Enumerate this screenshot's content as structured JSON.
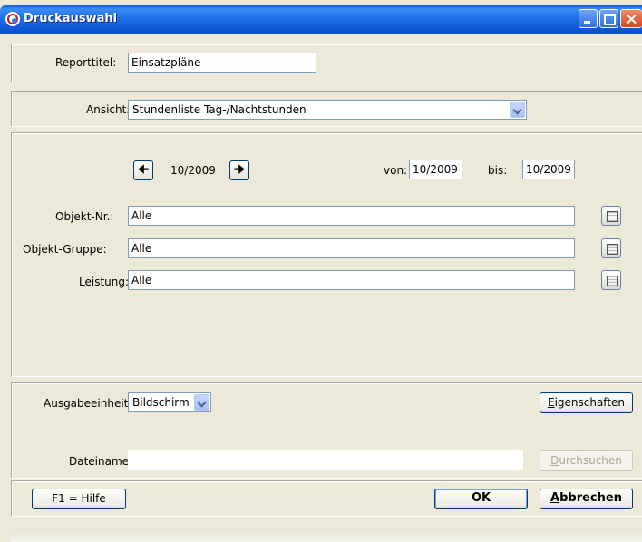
{
  "window": {
    "title": "Druckauswahl",
    "title_bar_color": "#0d59d6"
  },
  "report": {
    "label": "Reporttitel:",
    "value": "Einsatzpläne"
  },
  "view": {
    "label": "Ansicht:",
    "selected": "Stundenliste Tag-/Nachtstunden"
  },
  "period": {
    "current": "10/2009",
    "from_label": "von:",
    "from_value": "10/2009",
    "to_label": "bis:",
    "to_value": "10/2009",
    "prev_icon": "arrow-left-icon",
    "next_icon": "arrow-right-icon"
  },
  "filters": [
    {
      "label": "Objekt-Nr.:",
      "value": "Alle"
    },
    {
      "label": "Objekt-Gruppe:",
      "value": "Alle"
    },
    {
      "label": "Leistung:",
      "value": "Alle"
    }
  ],
  "output": {
    "label": "Ausgabeeinheit:",
    "selected": "Bildschirm",
    "properties_prefix": "E",
    "properties_rest": "igenschaften"
  },
  "file": {
    "label": "Dateiname:",
    "value": "",
    "browse_prefix": "D",
    "browse_rest": "urchsuchen"
  },
  "footer": {
    "help_label": "F1 = Hilfe",
    "ok_label": "OK",
    "cancel_prefix": "A",
    "cancel_rest": "bbrechen"
  }
}
